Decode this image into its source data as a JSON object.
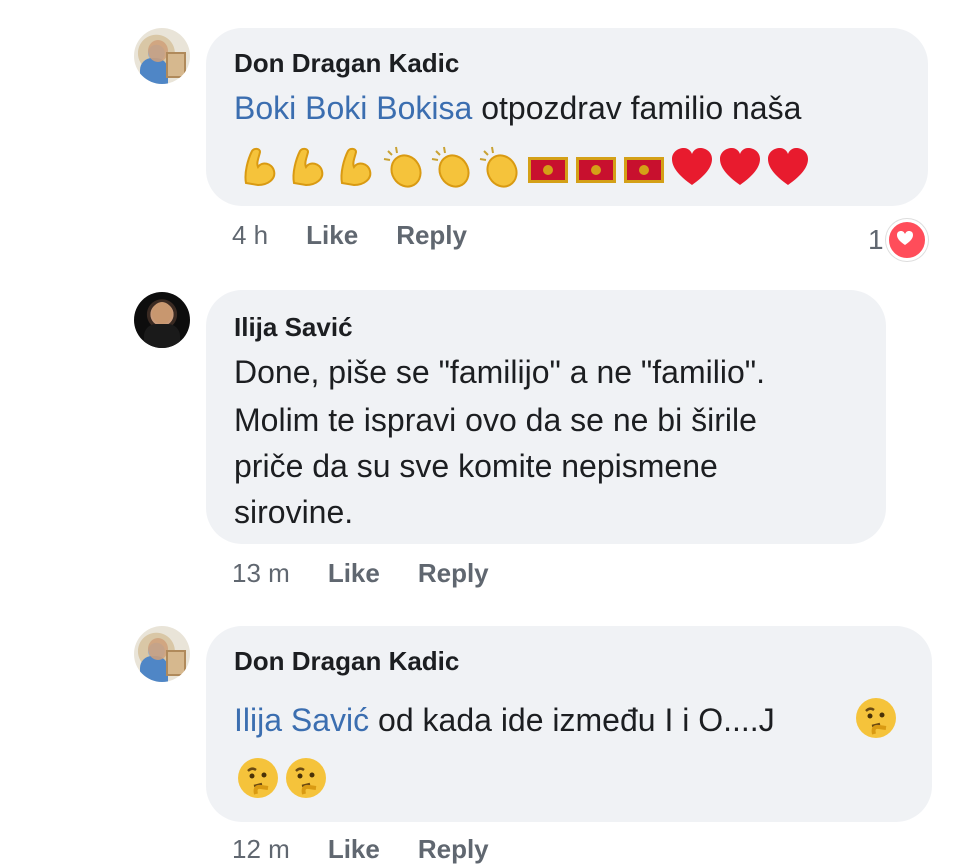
{
  "comments": [
    {
      "author": "Don Dragan Kadic",
      "mention": "Boki Boki Bokisa",
      "text": " otpozdrav familio naša",
      "emoji": [
        "flexed-biceps",
        "flexed-biceps",
        "flexed-biceps",
        "clapping-hands",
        "clapping-hands",
        "clapping-hands",
        "montenegro-flag",
        "montenegro-flag",
        "montenegro-flag",
        "red-heart",
        "red-heart",
        "red-heart"
      ],
      "time": "4 h",
      "like_label": "Like",
      "reply_label": "Reply",
      "reaction_count": "1",
      "reaction_icon": "heart-icon"
    },
    {
      "author": "Ilija Savić",
      "lines": [
        "Done, piše se \"familijo\" a ne \"familio\".",
        "Molim te ispravi ovo da se ne bi širile",
        "priče da su sve komite nepismene",
        "sirovine."
      ],
      "time": "13 m",
      "like_label": "Like",
      "reply_label": "Reply"
    },
    {
      "author": "Don Dragan Kadic",
      "mention": "Ilija Savić",
      "text": " od kada ide između I i O....J",
      "emoji": [
        "thinking-face",
        "thinking-face",
        "thinking-face"
      ],
      "time": "12 m",
      "like_label": "Like",
      "reply_label": "Reply"
    }
  ],
  "colors": {
    "bubble": "#f0f2f5",
    "mention": "#3b6eb0",
    "meta": "#606770",
    "heart": "#ff4d5a"
  }
}
